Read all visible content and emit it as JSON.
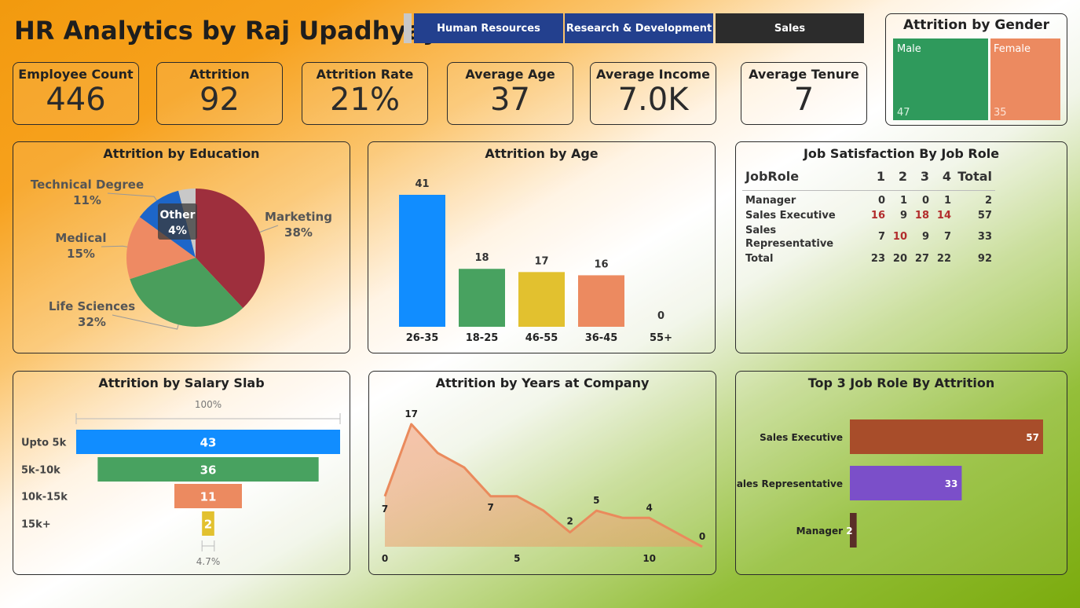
{
  "title": "HR Analytics by Raj Upadhyay",
  "departments": [
    "Human Resources",
    "Research & Development",
    "Sales"
  ],
  "kpis": [
    {
      "label": "Employee Count",
      "value": "446"
    },
    {
      "label": "Attrition",
      "value": "92"
    },
    {
      "label": "Attrition Rate",
      "value": "21%"
    },
    {
      "label": "Average Age",
      "value": "37"
    },
    {
      "label": "Average Income",
      "value": "7.0K"
    },
    {
      "label": "Average Tenure",
      "value": "7"
    }
  ],
  "gender": {
    "title": "Attrition by Gender",
    "male_label": "Male",
    "male_value": "47",
    "female_label": "Female",
    "female_value": "35"
  },
  "education": {
    "title": "Attrition by Education"
  },
  "age": {
    "title": "Attrition by Age"
  },
  "jobsat": {
    "title": "Job Satisfaction By Job Role",
    "headers": [
      "JobRole",
      "1",
      "2",
      "3",
      "4",
      "Total"
    ],
    "rows": [
      [
        "Manager",
        "0",
        "1",
        "0",
        "1",
        "2"
      ],
      [
        "Sales Executive",
        "16",
        "9",
        "18",
        "14",
        "57"
      ],
      [
        "Sales Representative",
        "7",
        "10",
        "9",
        "7",
        "33"
      ],
      [
        "Total",
        "23",
        "20",
        "27",
        "22",
        "92"
      ]
    ]
  },
  "salary": {
    "title": "Attrition by Salary Slab",
    "top_pct": "100%",
    "bottom_pct": "4.7%"
  },
  "years": {
    "title": "Attrition by Years at Company"
  },
  "toproles": {
    "title": "Top 3 Job Role By Attrition"
  },
  "chart_data": [
    {
      "type": "pie",
      "title": "Attrition by Education",
      "categories": [
        "Marketing",
        "Life Sciences",
        "Medical",
        "Technical Degree",
        "Other"
      ],
      "values": [
        38,
        32,
        15,
        11,
        4
      ],
      "labels": [
        "38%",
        "32%",
        "15%",
        "11%",
        "4%"
      ],
      "colors": [
        "#9e2f3d",
        "#4a9e5c",
        "#ee8a63",
        "#1d66c9",
        "#c8c8c8"
      ]
    },
    {
      "type": "bar",
      "title": "Attrition by Age",
      "categories": [
        "26-35",
        "18-25",
        "46-55",
        "36-45",
        "55+"
      ],
      "values": [
        41,
        18,
        17,
        16,
        0
      ],
      "colors": [
        "#118dff",
        "#48a260",
        "#e2c12f",
        "#ec8a60",
        "#999999"
      ]
    },
    {
      "type": "bar",
      "title": "Attrition by Salary Slab",
      "categories": [
        "Upto 5k",
        "5k-10k",
        "10k-15k",
        "15k+"
      ],
      "values": [
        43,
        36,
        11,
        2
      ],
      "colors": [
        "#118dff",
        "#48a260",
        "#ec8a60",
        "#e2c12f"
      ]
    },
    {
      "type": "area",
      "title": "Attrition by Years at Company",
      "x": [
        0,
        1,
        2,
        3,
        4,
        5,
        6,
        7,
        8,
        9,
        10,
        11,
        12
      ],
      "values": [
        7,
        17,
        13,
        11,
        7,
        7,
        5,
        2,
        5,
        4,
        4,
        2,
        0
      ],
      "shown_labels": {
        "0": "7",
        "1": "17",
        "4": "7",
        "7": "2",
        "8": "5",
        "10": "4",
        "12": "0"
      },
      "xticks": [
        0,
        5,
        10
      ]
    },
    {
      "type": "bar",
      "title": "Top 3 Job Role By Attrition",
      "categories": [
        "Sales Executive",
        "Sales Representative",
        "Manager"
      ],
      "values": [
        57,
        33,
        2
      ],
      "colors": [
        "#a84d2a",
        "#7b4fc9",
        "#5a2e28"
      ]
    }
  ]
}
